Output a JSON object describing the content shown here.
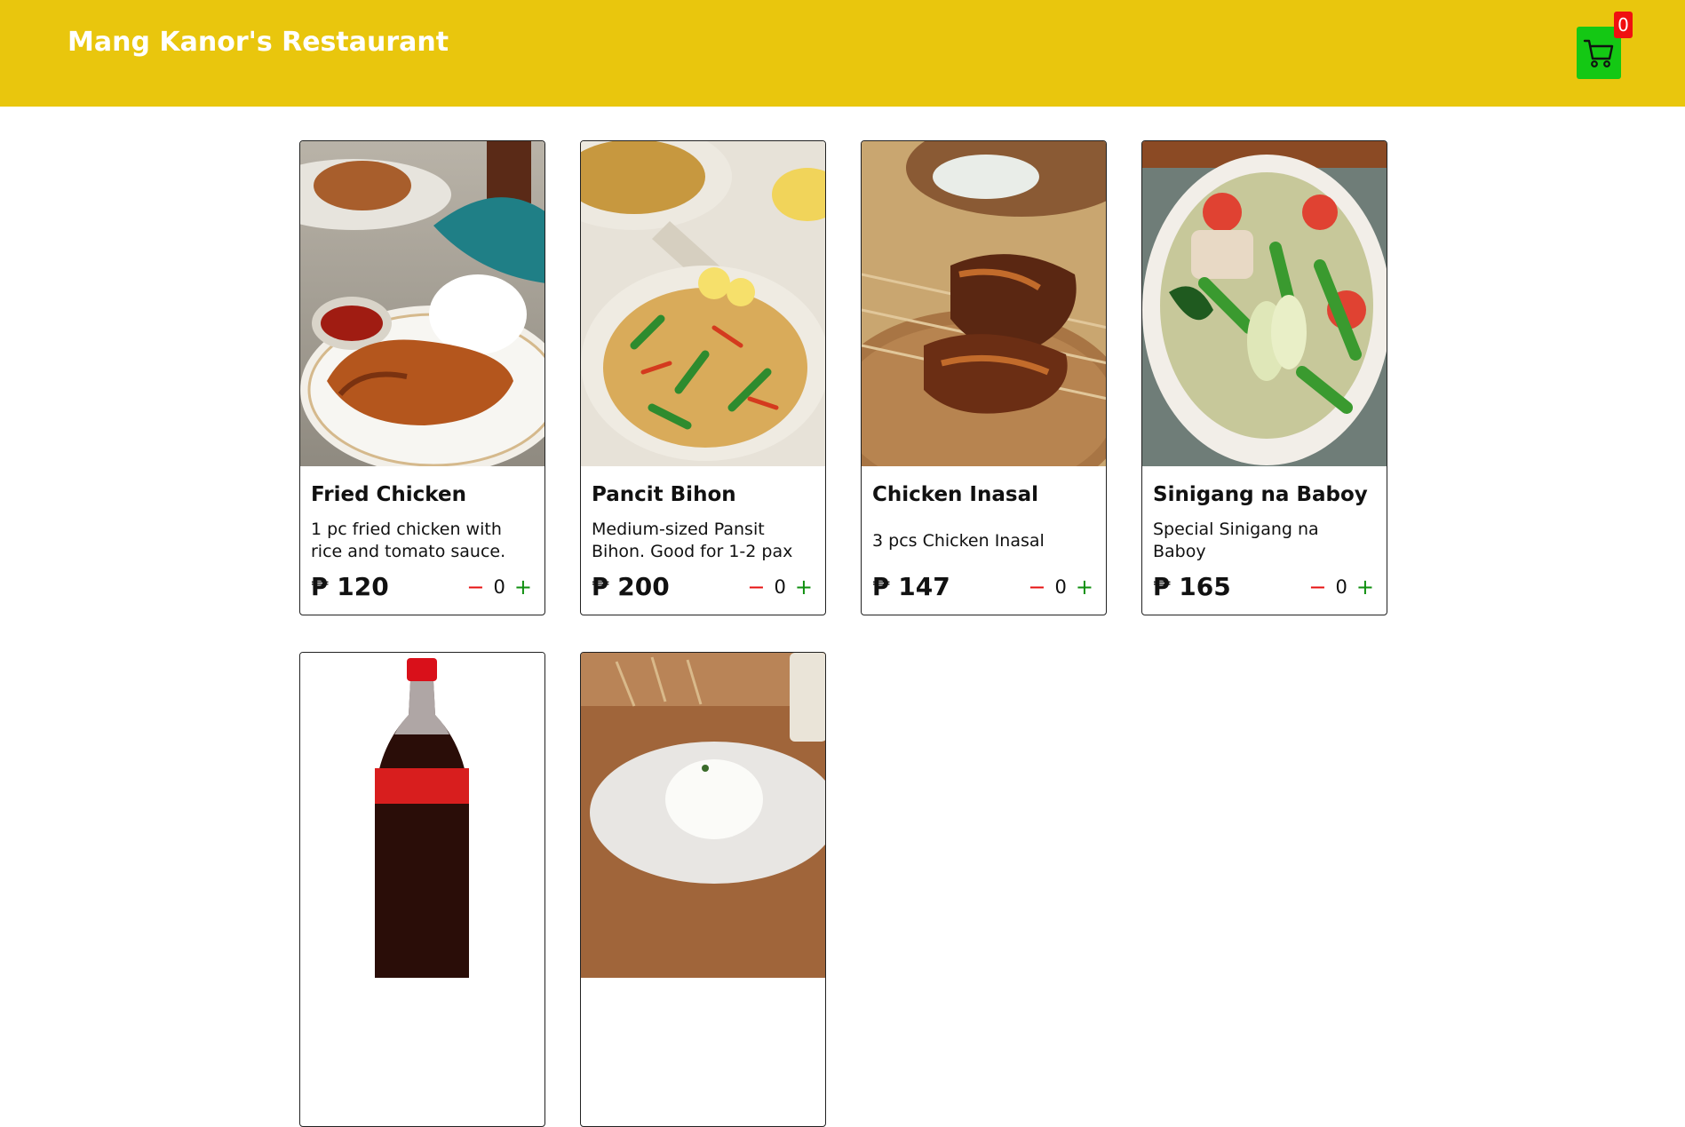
{
  "header": {
    "title": "Mang Kanor's Restaurant",
    "cart_count": "0"
  },
  "colors": {
    "header": "#e9c60d",
    "cart_button": "#14c814",
    "cart_badge": "#f01010",
    "minus": "#e61010",
    "plus": "#0f8f0f"
  },
  "icons": {
    "cart": "shopping-cart-icon",
    "minus": "minus-icon",
    "plus": "plus-icon"
  },
  "menu": {
    "items": [
      {
        "name": "Fried Chicken",
        "description": "1 pc fried chicken with rice and tomato sauce.",
        "price": "₱ 120",
        "quantity": "0",
        "photo": "fried chicken with rice and sauce"
      },
      {
        "name": "Pancit Bihon",
        "description": "Medium-sized Pansit Bihon. Good for 1-2 pax",
        "price": "₱ 200",
        "quantity": "0",
        "photo": "pancit bihon noodles"
      },
      {
        "name": "Chicken Inasal",
        "description": "3 pcs Chicken Inasal",
        "price": "₱ 147",
        "quantity": "0",
        "photo": "grilled chicken skewers"
      },
      {
        "name": "Sinigang na Baboy",
        "description": "Special Sinigang na Baboy",
        "price": "₱ 165",
        "quantity": "0",
        "photo": "sinigang soup"
      },
      {
        "name": "",
        "description": "",
        "price": "",
        "quantity": "",
        "photo": "soda bottle"
      },
      {
        "name": "",
        "description": "",
        "price": "",
        "quantity": "",
        "photo": "plated rice"
      }
    ]
  },
  "controls": {
    "minus_label": "−",
    "plus_label": "+"
  }
}
